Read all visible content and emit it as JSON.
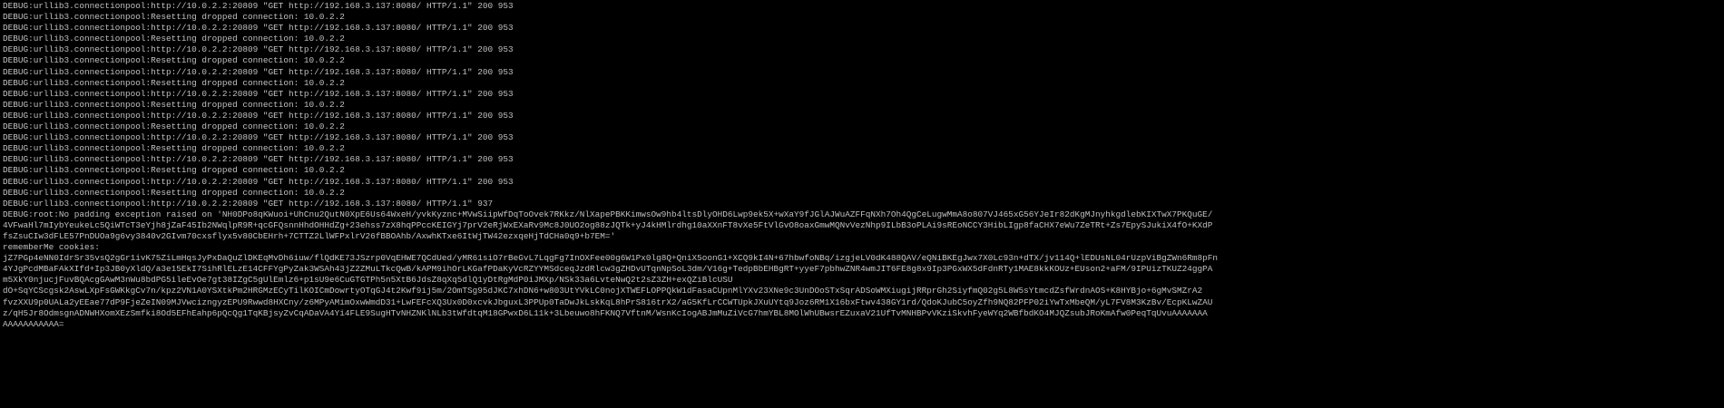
{
  "colors": {
    "background": "#000000",
    "text": "#c0c0c0"
  },
  "log_lines": [
    "DEBUG:urllib3.connectionpool:http://10.0.2.2:20809 \"GET http://192.168.3.137:8080/ HTTP/1.1\" 200 953",
    "DEBUG:urllib3.connectionpool:Resetting dropped connection: 10.0.2.2",
    "DEBUG:urllib3.connectionpool:http://10.0.2.2:20809 \"GET http://192.168.3.137:8080/ HTTP/1.1\" 200 953",
    "DEBUG:urllib3.connectionpool:Resetting dropped connection: 10.0.2.2",
    "DEBUG:urllib3.connectionpool:http://10.0.2.2:20809 \"GET http://192.168.3.137:8080/ HTTP/1.1\" 200 953",
    "DEBUG:urllib3.connectionpool:Resetting dropped connection: 10.0.2.2",
    "DEBUG:urllib3.connectionpool:http://10.0.2.2:20809 \"GET http://192.168.3.137:8080/ HTTP/1.1\" 200 953",
    "DEBUG:urllib3.connectionpool:Resetting dropped connection: 10.0.2.2",
    "DEBUG:urllib3.connectionpool:http://10.0.2.2:20809 \"GET http://192.168.3.137:8080/ HTTP/1.1\" 200 953",
    "DEBUG:urllib3.connectionpool:Resetting dropped connection: 10.0.2.2",
    "DEBUG:urllib3.connectionpool:http://10.0.2.2:20809 \"GET http://192.168.3.137:8080/ HTTP/1.1\" 200 953",
    "DEBUG:urllib3.connectionpool:Resetting dropped connection: 10.0.2.2",
    "DEBUG:urllib3.connectionpool:http://10.0.2.2:20809 \"GET http://192.168.3.137:8080/ HTTP/1.1\" 200 953",
    "DEBUG:urllib3.connectionpool:Resetting dropped connection: 10.0.2.2",
    "DEBUG:urllib3.connectionpool:http://10.0.2.2:20809 \"GET http://192.168.3.137:8080/ HTTP/1.1\" 200 953",
    "DEBUG:urllib3.connectionpool:Resetting dropped connection: 10.0.2.2",
    "DEBUG:urllib3.connectionpool:http://10.0.2.2:20809 \"GET http://192.168.3.137:8080/ HTTP/1.1\" 200 953",
    "DEBUG:urllib3.connectionpool:Resetting dropped connection: 10.0.2.2",
    "DEBUG:urllib3.connectionpool:http://10.0.2.2:20809 \"GET http://192.168.3.137:8080/ HTTP/1.1\" 937"
  ],
  "exception_lines": [
    "DEBUG:root:No padding exception raised on 'NH0DPo8qKWuoi+UhCnu2QutN0XpE6Us64WxeH/yvkKyznc+MVwSiipWfDqToOvek7RKkz/NlXapePBKKimwsOw9hb4ltsDlyOHD6Lwp9ek5X+wXaY9fJGlAJWuAZFFqNXh7Oh4QgCeLugwMmA8o807VJ465xG56YJeIr82dKgMJnyhkgdlebKIXTwX7PKQuGE/",
    "4VFwaHl7mIybYeukeLc5QiWTcT3eYjh8jZaF45Ib2NWqlpR9R+qcGFQsnnHhdOHHdZg+23ehss7zX8hqPPccKEIGYj7prV2eRjWxEXaRv9Mc8J0UO2og88zJQTk+yJ4kHMlrdhg10aXXnFT8vXe5FtVlGvO8oaxGmwMQNvVezNhp9ILbB3oPLAi9sREoNCCY3HibLIgp8faCHX7eWu7ZeTRt+Zs7EpySJukiX4fO+KXdP",
    "fsZsuCIw3dFLE57PnDUOa9g6vy3840v2GIvm70cxsflyx5v80CbEHrh+7CTTZ2LlWFPxlrV26fBBOAhb/AxwhKTxe6ItWjTW42ezxqeHjTdCHa0q9+b7EM='"
  ],
  "cookies_label": "rememberMe cookies:",
  "cookie_lines": [
    "jZ7PGp4eNN0IdrSr35vsQ2gGr1ivK75ZiLmHqsJyPxDaQuZlDKEqMvDh6iuw/flQdKE73JSzrp0VqEHWE7QCdUed/yMR61siO7rBeGvL7LqgFg7InOXFee00g6W1Px0lg8Q+QniX5oonG1+XCQ9kI4N+67hbwfoNBq/izgjeLV0dK488QAV/eQNiBKEgJwx7X0Lc93n+dTX/jv114Q+lEDUsNL04rUzpViBgZWn6Rm8pFn",
    "4YJgPcdMBaFAkXIfd+Ip3JB0yXldQ/a3e15EkI7SihRlELzE14CFFYgPyZak3WSAh43jZ2ZMuLTkcQwB/kAPM9ihOrLKGafPDaKyVcRZYYMSdceqJzdRlcw3gZHDvUTqnNpSoL3dm/V16g+TedpBbEHBgRT+yyeF7pbhwZNR4wmJIT6FE8g8x9Ip3PGxWX5dFdnRTy1MAE8kkKOUz+EUson2+aFM/9IPUizTKUZ24ggPA",
    "m5XkY0njucjFuvBQAcgGAwM3nWu8bdPG5ileEvOe7gt38IZgC5gUlEmlz6+p1sU9e6CuGTGTPh5n5XtB6JdsZ8qXq5dlQ1yDtRgMdP0iJMXp/NSk33a6LvteNwQ2t2sZ3ZH+exQZiBlcUSU",
    "dO+SqYCScgsk2AswLXpFsGWKkgCv7n/kpz2VN1A0YSXtkPm2HRGMzECyTilKOICmDowrtyOTqGJ4t2Kwf9ij5m/2OmTSg95dJKC7xhDN6+w803UtYVkLC0nojXTWEFLOPPQkW1dFasaCUpnMlYXv23XNe9c3UnDOoSTxSqrADSoWMXiugijRRprGh2SiyfmQ02g5L8W5sYtmcdZsfWrdnAOS+K8HYBjo+6gMvSMZrA2",
    "fvzXXU9p0UALa2yEEae77dP9FjeZeIN09MJVwcizngyzEPU9Rwwd8HXCny/z6MPyAMimOxwWmdD31+LwFEFcXQ3Ux0D0xcvkJbguxL3PPUp0TaDwJkLskKqL8hPrS816trX2/aG5KfLrCCWTUpkJXuUYtq9Joz6RM1X16bxFtwv438GY1rd/QdoKJubC5oyZfh9NQ82PFP02iYwTxMbeQM/yL7FV8M3KzBv/EcpKLwZAU",
    "z/qH5Jr8OdmsgnADNWHXomXEzSmfki8Od5EFhEahp6pQcQg1TqKBjsyZvCqADaVA4Yi4FLE9SugHTvNHZNKlNLb3tWfdtqM18GPwxD6L11k+3Lbeuwo8hFKNQ7VftnM/WsnKcIogABJmMuZiVcG7hmYBL8MOlWhUBwsrEZuxaV21UfTvMNHBPvVKziSkvhFyeWYq2WBfbdKO4MJQZsubJRoKmAfw0PeqTqUvuAAAAAAA",
    "AAAAAAAAAAA="
  ]
}
